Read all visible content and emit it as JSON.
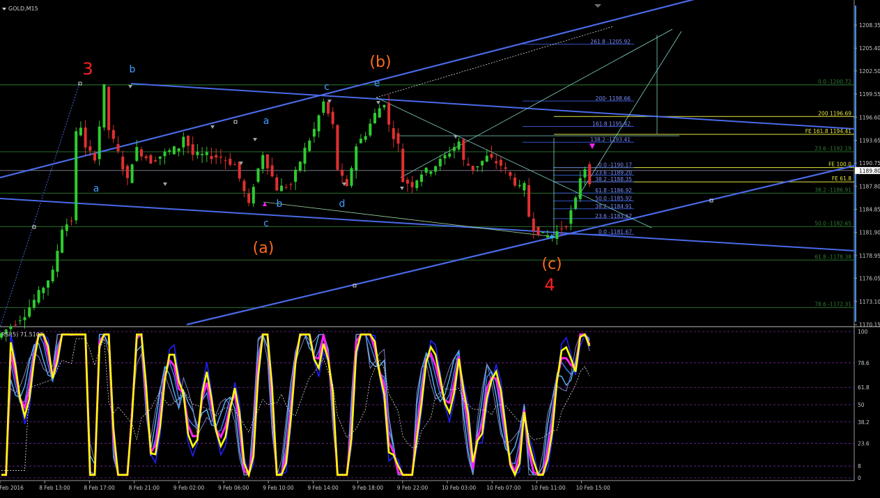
{
  "window": {
    "title": "GOLD,M15",
    "menu_icon": "triangle-down-icon"
  },
  "colors": {
    "background": "#000000",
    "up_candle": "#2ecc2e",
    "down_candle": "#e03030",
    "trendline": "#4a6ae8",
    "fib_retrace": "#2e7d32",
    "fib_ext": "#3a5fe0",
    "fe_lines": "#e8e840",
    "wave_red": "#ff2020",
    "wave_orange": "#ff6a1a",
    "wave_blue": "#3fa0ff",
    "rsi_yellow": "#ffff00",
    "rsi_magenta": "#ff22ff"
  },
  "chart_data": [
    {
      "type": "candlestick",
      "symbol": "GOLD",
      "timeframe": "M15",
      "ylim": [
        1170.15,
        1208.35
      ],
      "y_ticks": [
        "1208.35",
        "1205.40",
        "1202.50",
        "1199.55",
        "1196.60",
        "1193.65",
        "1190.75",
        "1187.80",
        "1184.85",
        "1181.90",
        "1178.95",
        "1176.05",
        "1173.10",
        "1170.15"
      ],
      "current_price": "1189.80",
      "x_ticks": [
        "8 Feb 2016",
        "8 Feb 13:00",
        "8 Feb 17:00",
        "8 Feb 21:00",
        "9 Feb 02:00",
        "9 Feb 06:00",
        "9 Feb 10:00",
        "9 Feb 14:00",
        "9 Feb 18:00",
        "9 Feb 22:00",
        "10 Feb 03:00",
        "10 Feb 07:00",
        "10 Feb 11:00",
        "10 Feb 15:00"
      ],
      "price_path": [
        [
          0,
          1168.5
        ],
        [
          6,
          1171.5
        ],
        [
          10,
          1175.0
        ],
        [
          12,
          1176.8
        ],
        [
          14,
          1182.5
        ],
        [
          16,
          1183.5
        ],
        [
          17,
          1194.5
        ],
        [
          18,
          1195.5
        ],
        [
          19,
          1192.5
        ],
        [
          21,
          1191.5
        ],
        [
          22,
          1195.5
        ],
        [
          23,
          1200.4
        ],
        [
          24,
          1195.0
        ],
        [
          26,
          1192.0
        ],
        [
          28,
          1188.5
        ],
        [
          29,
          1191.0
        ],
        [
          30,
          1192.5
        ],
        [
          33,
          1191.0
        ],
        [
          36,
          1192.0
        ],
        [
          39,
          1192.8
        ],
        [
          40,
          1194.2
        ],
        [
          42,
          1191.8
        ],
        [
          45,
          1191.7
        ],
        [
          48,
          1191.5
        ],
        [
          51,
          1190.5
        ],
        [
          54,
          1185.3
        ],
        [
          55,
          1188.0
        ],
        [
          57,
          1192.0
        ],
        [
          60,
          1187.5
        ],
        [
          63,
          1188.0
        ],
        [
          66,
          1192.5
        ],
        [
          68,
          1195.0
        ],
        [
          70,
          1198.5
        ],
        [
          72,
          1195.5
        ],
        [
          73,
          1190.0
        ],
        [
          75,
          1187.5
        ],
        [
          77,
          1193.0
        ],
        [
          79,
          1194.5
        ],
        [
          81,
          1197.0
        ],
        [
          83,
          1198.5
        ],
        [
          84,
          1195.5
        ],
        [
          86,
          1193.0
        ],
        [
          87,
          1188.5
        ],
        [
          89,
          1188.0
        ],
        [
          91,
          1189.5
        ],
        [
          93,
          1190.0
        ],
        [
          95,
          1191.0
        ],
        [
          97,
          1192.2
        ],
        [
          99,
          1193.5
        ],
        [
          100,
          1191.0
        ],
        [
          102,
          1190.0
        ],
        [
          105,
          1191.5
        ],
        [
          108,
          1190.5
        ],
        [
          110,
          1189.0
        ],
        [
          112,
          1187.5
        ],
        [
          113,
          1187.8
        ],
        [
          114,
          1184.0
        ],
        [
          115,
          1182.5
        ],
        [
          117,
          1181.5
        ],
        [
          119,
          1181.5
        ],
        [
          121,
          1182.5
        ],
        [
          122,
          1183.0
        ],
        [
          124,
          1186.0
        ],
        [
          125,
          1189.0
        ],
        [
          126,
          1190.2
        ],
        [
          127,
          1188.5
        ]
      ],
      "horizontal_levels": [
        {
          "price": 1200.72,
          "label": "0.0 -1200.72",
          "color": "fib_retrace"
        },
        {
          "price": 1192.19,
          "label": "23.6 -1192.19",
          "color": "fib_retrace"
        },
        {
          "price": 1186.91,
          "label": "38.2 -1186.91",
          "color": "fib_retrace"
        },
        {
          "price": 1182.65,
          "label": "50.0 -1182.65",
          "color": "fib_retrace"
        },
        {
          "price": 1178.38,
          "label": "61.8 -1178.38",
          "color": "fib_retrace"
        },
        {
          "price": 1172.31,
          "label": "78.6 -1172.31",
          "color": "fib_retrace"
        },
        {
          "price": 1196.69,
          "label": "200 1196.69",
          "color": "fe_lines"
        },
        {
          "price": 1194.41,
          "label": "FE 161.8 1194.41",
          "color": "fe_lines"
        },
        {
          "price": 1190.17,
          "label": "FE 100.0",
          "color": "fe_lines"
        },
        {
          "price": 1188.35,
          "label": "FE 61.8",
          "color": "fe_lines"
        }
      ],
      "fib_extension_labels": [
        {
          "price": 1205.92,
          "label": "261.8 -1205.92"
        },
        {
          "price": 1198.66,
          "label": "200- 1198.66"
        },
        {
          "price": 1195.42,
          "label": "161.8 1195.42"
        },
        {
          "price": 1193.41,
          "label": "138.2 -1193.41"
        },
        {
          "price": 1190.17,
          "label": "0.0 -1190.17"
        },
        {
          "price": 1189.2,
          "label": "23.6 -1189.20"
        },
        {
          "price": 1188.35,
          "label": "38.2 -1188.35"
        },
        {
          "price": 1186.92,
          "label": "61.8 -1186.92"
        },
        {
          "price": 1185.92,
          "label": "50.0 -1185.92"
        },
        {
          "price": 1184.91,
          "label": "38.2 -1184.91"
        },
        {
          "price": 1183.67,
          "label": "23.6 -1183.67"
        },
        {
          "price": 1181.67,
          "label": "0.0 -1181.67"
        }
      ],
      "wave_labels": [
        {
          "text": "3",
          "color": "wave_red"
        },
        {
          "text": "b",
          "color": "wave_blue"
        },
        {
          "text": "a",
          "color": "wave_blue"
        },
        {
          "text": "a",
          "color": "wave_blue"
        },
        {
          "text": "b",
          "color": "wave_blue"
        },
        {
          "text": "c",
          "color": "wave_blue"
        },
        {
          "text": "(a)",
          "color": "wave_orange"
        },
        {
          "text": "c",
          "color": "wave_blue"
        },
        {
          "text": "d",
          "color": "wave_blue"
        },
        {
          "text": "(b)",
          "color": "wave_orange"
        },
        {
          "text": "e",
          "color": "wave_blue"
        },
        {
          "text": "(c)",
          "color": "wave_orange"
        },
        {
          "text": "4",
          "color": "wave_red"
        }
      ]
    },
    {
      "type": "line",
      "title": "RSI(5) 71.5102",
      "ylim": [
        0,
        100
      ],
      "y_ticks": [
        "100",
        "78.6",
        "61.8",
        "50",
        "38.2",
        "23.6",
        "8",
        "0"
      ]
    }
  ]
}
